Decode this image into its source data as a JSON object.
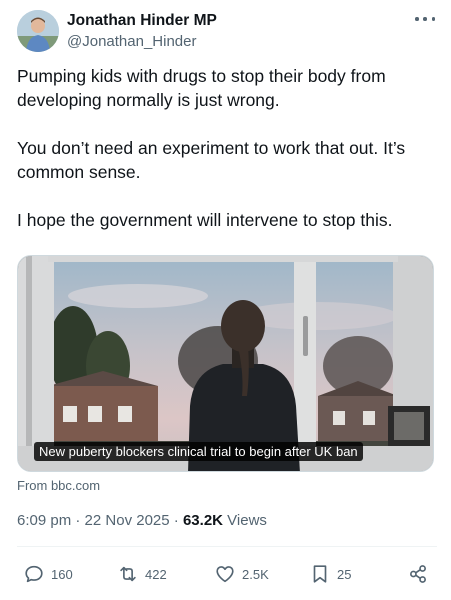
{
  "author": {
    "display_name": "Jonathan Hinder MP",
    "handle": "@Jonathan_Hinder",
    "avatar_icon": "avatar-photo"
  },
  "tweet": {
    "paragraphs": [
      "Pumping kids with drugs to stop their body from developing normally is just wrong.",
      "You don’t need an experiment to work that out. It’s common sense.",
      "I hope the government will intervene to stop this."
    ]
  },
  "card": {
    "headline": "New puberty blockers clinical trial to begin after UK ban",
    "source": "From bbc.com"
  },
  "meta": {
    "time": "6:09 pm",
    "separator": "·",
    "date": "22 Nov 2025",
    "views_count": "63.2K",
    "views_label": "Views"
  },
  "actions": {
    "replies": "160",
    "reposts": "422",
    "likes": "2.5K",
    "bookmarks": "25"
  },
  "colors": {
    "text_primary": "#0f1419",
    "text_secondary": "#536471",
    "divider": "#eff3f4"
  }
}
